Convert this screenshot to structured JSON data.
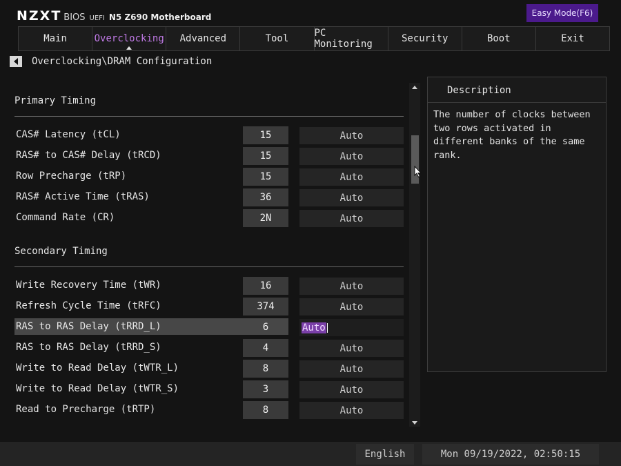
{
  "brand": {
    "logo": "NZXT",
    "bios": "BIOS",
    "uefi": "UEFI",
    "board": "N5 Z690 Motherboard"
  },
  "easy_mode": "Easy Mode(F6)",
  "tabs": [
    {
      "label": "Main"
    },
    {
      "label": "Overclocking",
      "active": true
    },
    {
      "label": "Advanced"
    },
    {
      "label": "Tool"
    },
    {
      "label": "PC Monitoring"
    },
    {
      "label": "Security"
    },
    {
      "label": "Boot"
    },
    {
      "label": "Exit"
    }
  ],
  "breadcrumb": "Overclocking\\DRAM Configuration",
  "primary": {
    "title": "Primary Timing",
    "rows": [
      {
        "label": "CAS# Latency (tCL)",
        "value": "15",
        "mode": "Auto"
      },
      {
        "label": "RAS# to CAS# Delay (tRCD)",
        "value": "15",
        "mode": "Auto"
      },
      {
        "label": "Row Precharge (tRP)",
        "value": "15",
        "mode": "Auto"
      },
      {
        "label": "RAS# Active Time (tRAS)",
        "value": "36",
        "mode": "Auto"
      },
      {
        "label": "Command Rate (CR)",
        "value": "2N",
        "mode": "Auto"
      }
    ]
  },
  "secondary": {
    "title": "Secondary Timing",
    "rows": [
      {
        "label": "Write Recovery Time (tWR)",
        "value": "16",
        "mode": "Auto"
      },
      {
        "label": "Refresh Cycle Time (tRFC)",
        "value": "374",
        "mode": "Auto"
      },
      {
        "label": "RAS to RAS Delay (tRRD_L)",
        "value": "6",
        "mode": "Auto",
        "selected": true
      },
      {
        "label": "RAS to RAS Delay (tRRD_S)",
        "value": "4",
        "mode": "Auto"
      },
      {
        "label": "Write to Read Delay (tWTR_L)",
        "value": "8",
        "mode": "Auto"
      },
      {
        "label": "Write to Read Delay (tWTR_S)",
        "value": "3",
        "mode": "Auto"
      },
      {
        "label": "Read to Precharge (tRTP)",
        "value": "8",
        "mode": "Auto"
      }
    ]
  },
  "description": {
    "title": "Description",
    "text": "The number of clocks between two rows activated in different banks of the same rank."
  },
  "footer": {
    "language": "English",
    "datetime": "Mon 09/19/2022, 02:50:15"
  },
  "colors": {
    "accent": "#c07ae6",
    "easy_mode_bg": "#4b1a8c"
  }
}
